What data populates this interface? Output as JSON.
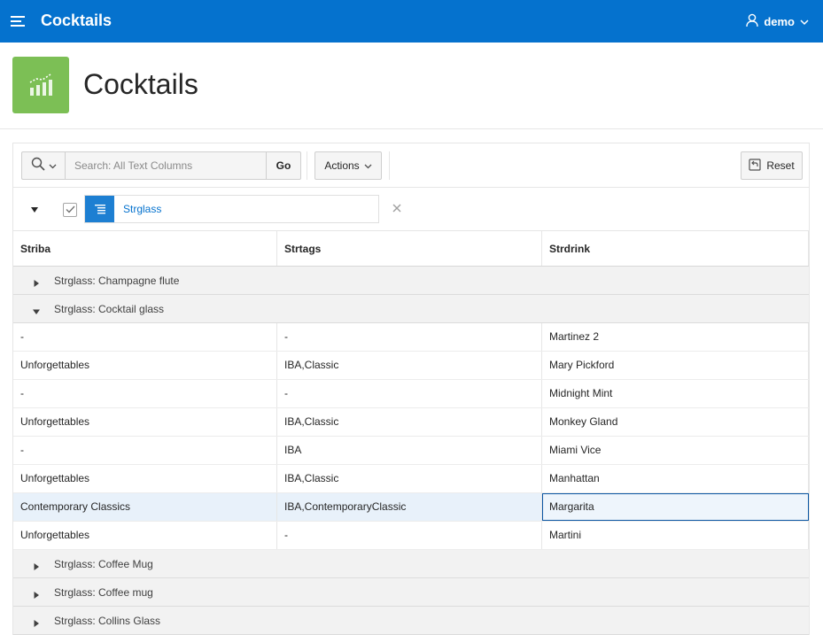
{
  "header": {
    "app_title": "Cocktails",
    "user": "demo",
    "brand_color": "#0572ce"
  },
  "hero": {
    "title": "Cocktails",
    "icon": "chart-icon",
    "icon_color": "#7cbf55"
  },
  "toolbar": {
    "search_placeholder": "Search: All Text Columns",
    "search_value": "",
    "go_label": "Go",
    "actions_label": "Actions",
    "reset_label": "Reset"
  },
  "filter": {
    "checked": true,
    "label": "Strglass"
  },
  "table": {
    "columns": [
      "Striba",
      "Strtags",
      "Strdrink"
    ],
    "group_prefix": "Strglass: ",
    "groups": [
      {
        "label": "Strglass: Champagne flute",
        "expanded": false,
        "rows": []
      },
      {
        "label": "Strglass: Cocktail glass",
        "expanded": true,
        "rows": [
          {
            "striba": "-",
            "strtags": "-",
            "strdrink": "Martinez 2"
          },
          {
            "striba": "Unforgettables",
            "strtags": "IBA,Classic",
            "strdrink": "Mary Pickford"
          },
          {
            "striba": "-",
            "strtags": "-",
            "strdrink": "Midnight Mint"
          },
          {
            "striba": "Unforgettables",
            "strtags": "IBA,Classic",
            "strdrink": "Monkey Gland"
          },
          {
            "striba": "-",
            "strtags": "IBA",
            "strdrink": "Miami Vice"
          },
          {
            "striba": "Unforgettables",
            "strtags": "IBA,Classic",
            "strdrink": "Manhattan"
          },
          {
            "striba": "Contemporary Classics",
            "strtags": "IBA,ContemporaryClassic",
            "strdrink": "Margarita",
            "selected": true
          },
          {
            "striba": "Unforgettables",
            "strtags": "-",
            "strdrink": "Martini"
          }
        ]
      },
      {
        "label": "Strglass: Coffee Mug",
        "expanded": false,
        "rows": []
      },
      {
        "label": "Strglass: Coffee mug",
        "expanded": false,
        "rows": []
      },
      {
        "label": "Strglass: Collins Glass",
        "expanded": false,
        "rows": []
      }
    ]
  }
}
